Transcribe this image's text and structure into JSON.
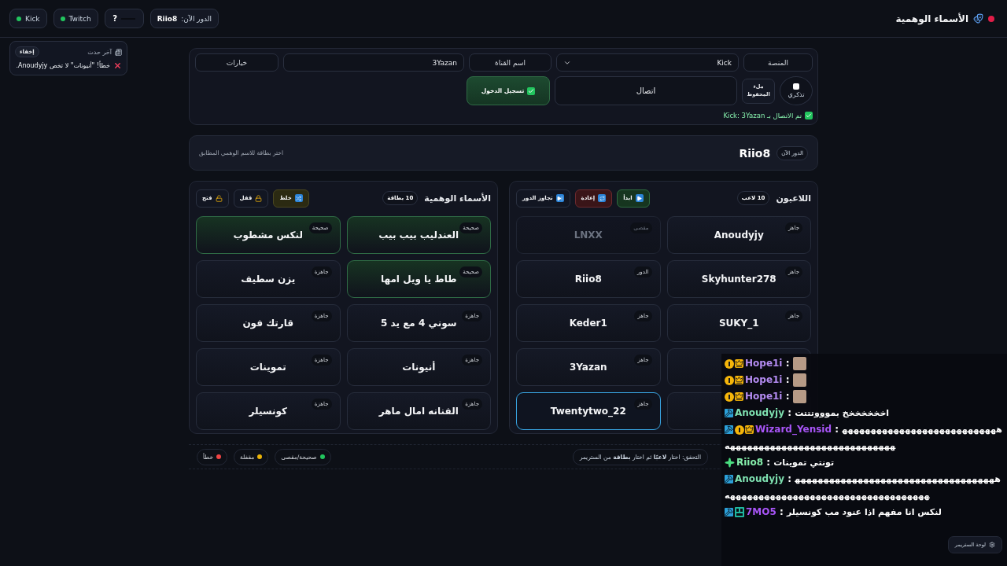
{
  "header": {
    "title": "الأسماء الوهمية",
    "pills": [
      {
        "kind": "turn",
        "label": "الدور الآن:",
        "value": "Riio8"
      },
      {
        "kind": "help",
        "label": "?"
      },
      {
        "kind": "status",
        "label": "Twitch",
        "on": true
      },
      {
        "kind": "status",
        "label": "Kick",
        "on": true
      }
    ]
  },
  "toast": {
    "title": "آخر حدث",
    "hide": "إخفاء",
    "message": "خطأ! \"أنيونات\" لا تخص Anoudyjy."
  },
  "connection": {
    "platform_label": "المنصة",
    "platform": "Kick",
    "channel_label": "اسم القناة",
    "channel": "3Yazan",
    "options": "خيارات",
    "remember": {
      "label": "تذكري",
      "checked": false
    },
    "fill_saved": "ملء المحفوظ",
    "connect": "اتصال",
    "login": "تسجيل الدخول",
    "status": "تم الاتصال بـ Kick: 3Yazan"
  },
  "turn": {
    "badge": "الدور الآن",
    "player": "Riio8",
    "hint": "اختر بطاقة للاسم الوهمي المطابق"
  },
  "players": {
    "title": "اللاعبون",
    "count": "10 لاعب",
    "buttons": [
      {
        "kind": "start",
        "label": "ابدأ"
      },
      {
        "kind": "reset",
        "label": "إعادة"
      },
      {
        "kind": "skip",
        "label": "تجاوز الدور"
      }
    ],
    "items": [
      {
        "name": "Anoudyjy",
        "status": "جاهز",
        "kind": "ready",
        "selected": false
      },
      {
        "name": "LNXX",
        "status": "مقصى",
        "kind": "out",
        "selected": false
      },
      {
        "name": "Skyhunter278",
        "status": "جاهز",
        "kind": "ready",
        "selected": false
      },
      {
        "name": "Riio8",
        "status": "الدور",
        "kind": "turn",
        "selected": false
      },
      {
        "name": "SUKY_1",
        "status": "جاهز",
        "kind": "ready",
        "selected": false
      },
      {
        "name": "Keder1",
        "status": "جاهز",
        "kind": "ready",
        "selected": false
      },
      {
        "kind": "covered",
        "selected": false
      },
      {
        "name": "3Yazan",
        "status": "جاهز",
        "kind": "ready",
        "selected": false
      },
      {
        "kind": "covered",
        "selected": false
      },
      {
        "name": "Twentytwo_22",
        "status": "جاهز",
        "kind": "ready",
        "selected": true
      }
    ]
  },
  "names": {
    "title": "الأسماء الوهمية",
    "count": "10 بطاقة",
    "buttons": [
      {
        "kind": "shuffle",
        "label": "خلط"
      },
      {
        "kind": "lock",
        "label": "قفل"
      },
      {
        "kind": "unlock",
        "label": "فتح"
      }
    ],
    "items": [
      {
        "name": "العندليب بيب بيب",
        "status": "صحيحة",
        "kind": "correct"
      },
      {
        "name": "لنكس مشطوب",
        "status": "صحيحة",
        "kind": "correct"
      },
      {
        "name": "طاط يا ويل امها",
        "status": "صحيحة",
        "kind": "correct"
      },
      {
        "name": "يزن سطيف",
        "status": "جاهزة",
        "kind": "ready"
      },
      {
        "name": "سوني 4 مع يد 5",
        "status": "جاهزة",
        "kind": "ready"
      },
      {
        "name": "قارتك فون",
        "status": "جاهزة",
        "kind": "ready"
      },
      {
        "name": "أنيونات",
        "status": "جاهزة",
        "kind": "ready"
      },
      {
        "name": "تموينات",
        "status": "جاهزة",
        "kind": "ready"
      },
      {
        "name": "الفنانه امال ماهر",
        "status": "جاهزة",
        "kind": "ready"
      },
      {
        "name": "كونسيلر",
        "status": "جاهزة",
        "kind": "ready"
      }
    ]
  },
  "legend": [
    {
      "label": "صحيحة/مقصى",
      "color": "#22c55e"
    },
    {
      "label": "مقفلة",
      "color": "#eab308"
    },
    {
      "label": "خطأ",
      "color": "#ef4444"
    }
  ],
  "hint": "التحقق: اختار **لاعبًا** ثم اختار **بطاقة** من الستريمر",
  "chat": {
    "messages": [
      {
        "badges": [
          {
            "kind": "sub"
          },
          {
            "kind": "crown"
          }
        ],
        "user": "Hope1i",
        "sep": ":",
        "color": "#b48cf2",
        "emote": true
      },
      {
        "badges": [
          {
            "kind": "sub"
          },
          {
            "kind": "crown"
          }
        ],
        "user": "Hope1i",
        "sep": ":",
        "color": "#b48cf2",
        "emote": true
      },
      {
        "badges": [
          {
            "kind": "sub"
          },
          {
            "kind": "crown"
          }
        ],
        "user": "Hope1i",
        "sep": ":",
        "color": "#b48cf2",
        "emote": true
      },
      {
        "badges": [
          {
            "kind": "mod"
          }
        ],
        "user": "Anoudyjy",
        "sep": ":",
        "color": "#7ee0b0",
        "text": "اخخخخخخخ بموووتتتت"
      },
      {
        "badges": [
          {
            "kind": "mod"
          },
          {
            "kind": "sub"
          },
          {
            "kind": "crown"
          }
        ],
        "user": "Wizard_Yensid",
        "sep": ":",
        "color": "#a855f7",
        "text": "هههههههههههههههههههههههههههههههههههههههههههههههههههههههههه"
      },
      {
        "badges": [
          {
            "kind": "vip"
          }
        ],
        "user": "Riio8",
        "sep": ":",
        "color": "#86efac",
        "text": "تونتي تموينات"
      },
      {
        "badges": [
          {
            "kind": "mod"
          }
        ],
        "user": "Anoudyjy",
        "sep": ":",
        "color": "#7ee0b0",
        "text": "هههههههههههههههههههههههههههههههههههههههههههههههههههههههههههههههههههههههه"
      },
      {
        "badges": [
          {
            "kind": "mod"
          },
          {
            "kind": "gg"
          }
        ],
        "user": "7MO5",
        "sep": ":",
        "color": "#a855f7",
        "text": "لنكس انا مفهم اذا عنود مب كونسيلر"
      }
    ],
    "panel_button": "لوحة الستريمر"
  }
}
